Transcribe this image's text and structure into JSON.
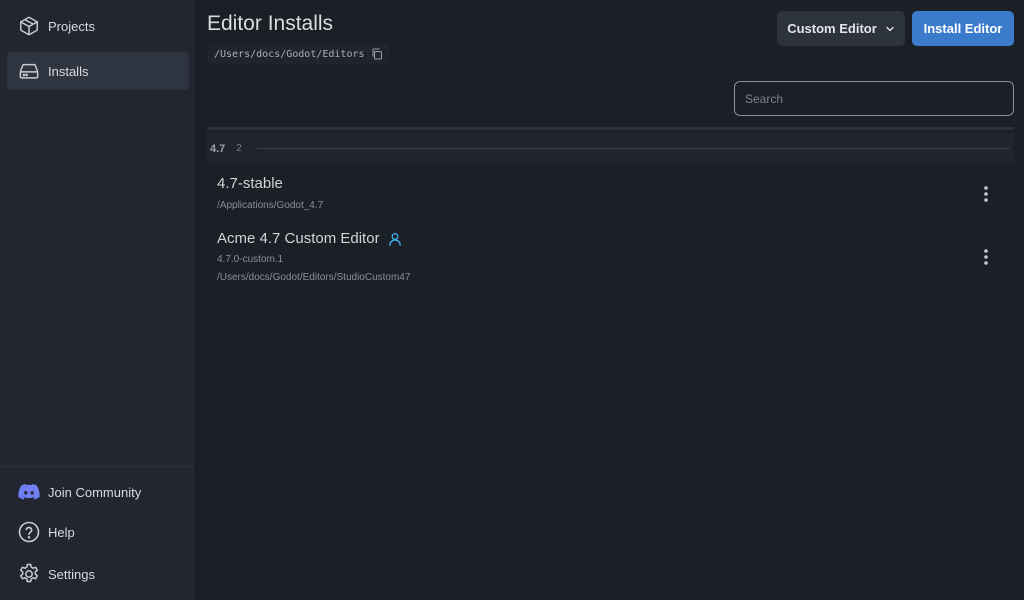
{
  "sidebar": {
    "items": [
      {
        "label": "Projects",
        "icon": "cube-icon"
      },
      {
        "label": "Installs",
        "icon": "drive-icon"
      }
    ],
    "bottom": [
      {
        "label": "Join Community",
        "icon": "discord-icon"
      },
      {
        "label": "Help",
        "icon": "help-icon"
      },
      {
        "label": "Settings",
        "icon": "gear-icon"
      }
    ]
  },
  "header": {
    "title": "Editor Installs",
    "path": "/Users/docs/Godot/Editors",
    "custom_editor_label": "Custom Editor",
    "install_editor_label": "Install Editor"
  },
  "search": {
    "placeholder": "Search",
    "value": ""
  },
  "groups": [
    {
      "version": "4.7",
      "count": "2",
      "installs": [
        {
          "name": "4.7-stable",
          "path": "/Applications/Godot_4.7"
        },
        {
          "name": "Acme 4.7 Custom Editor",
          "custom": true,
          "version_text": "4.7.0-custom.1",
          "path": "/Users/docs/Godot/Editors/StudioCustom47"
        }
      ]
    }
  ],
  "colors": {
    "accent": "#3b7bcc",
    "custom_badge": "#3aa8e0",
    "background": "#1b1f26",
    "sidebar": "#212630"
  }
}
